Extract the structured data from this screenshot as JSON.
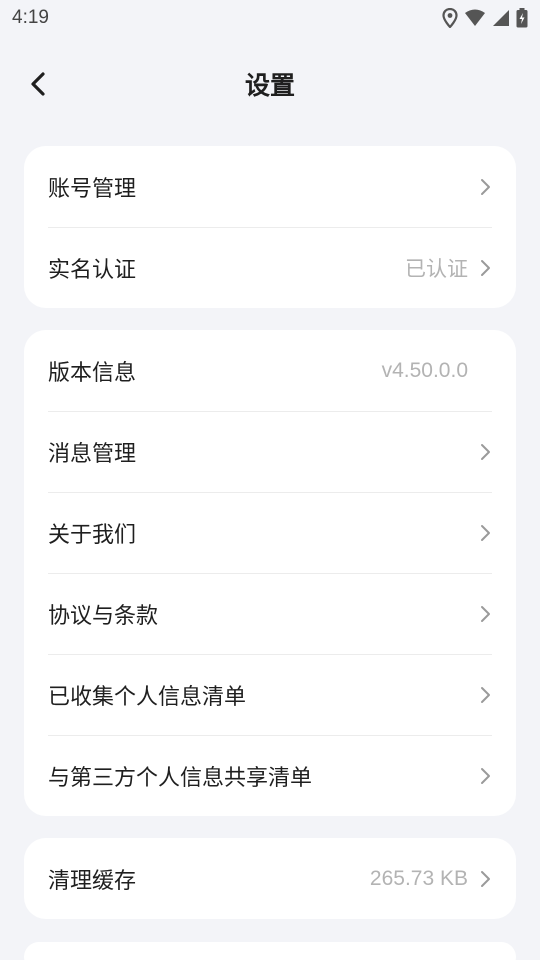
{
  "status_bar": {
    "time": "4:19",
    "icons": [
      "location-icon",
      "wifi-icon",
      "signal-icon",
      "battery-charging-icon"
    ]
  },
  "header": {
    "title": "设置",
    "back_icon": "chevron-left-icon"
  },
  "groups": [
    {
      "items": [
        {
          "label": "账号管理",
          "value": "",
          "arrow": true
        },
        {
          "label": "实名认证",
          "value": "已认证",
          "arrow": true
        }
      ]
    },
    {
      "items": [
        {
          "label": "版本信息",
          "value": "v4.50.0.0",
          "arrow": false
        },
        {
          "label": "消息管理",
          "value": "",
          "arrow": true
        },
        {
          "label": "关于我们",
          "value": "",
          "arrow": true
        },
        {
          "label": "协议与条款",
          "value": "",
          "arrow": true
        },
        {
          "label": "已收集个人信息清单",
          "value": "",
          "arrow": true
        },
        {
          "label": "与第三方个人信息共享清单",
          "value": "",
          "arrow": true
        }
      ]
    },
    {
      "items": [
        {
          "label": "清理缓存",
          "value": "265.73 KB",
          "arrow": true
        }
      ]
    }
  ],
  "colors": {
    "background": "#f3f4f8",
    "card": "#ffffff",
    "text": "#1f1f1f",
    "muted": "#b3b3b3"
  }
}
